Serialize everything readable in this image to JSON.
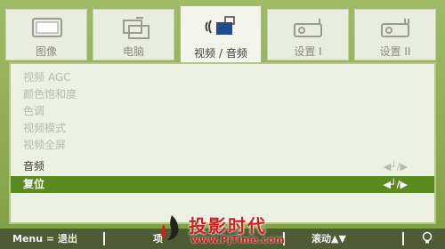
{
  "tabs": [
    {
      "label": "图像",
      "icon": "image-icon",
      "active": false
    },
    {
      "label": "电脑",
      "icon": "computer-icon",
      "active": false
    },
    {
      "label": "视频 / 音频",
      "icon": "audio-video-icon",
      "active": true
    },
    {
      "label": "设置 I",
      "icon": "projector-settings-1-icon",
      "active": false
    },
    {
      "label": "设置 II",
      "icon": "projector-settings-2-icon",
      "active": false
    }
  ],
  "menu": {
    "items": [
      {
        "label": "视频 AGC",
        "state": "disabled",
        "value": ""
      },
      {
        "label": "颜色饱和度",
        "state": "disabled",
        "value": ""
      },
      {
        "label": "色调",
        "state": "disabled",
        "value": ""
      },
      {
        "label": "视频模式",
        "state": "disabled",
        "value": ""
      },
      {
        "label": "视频全屏",
        "state": "disabled",
        "value": ""
      },
      {
        "label": "音频",
        "state": "normal",
        "value": "◀┘/▶"
      },
      {
        "label": "复位",
        "state": "selected",
        "value": "◀┘/▶"
      }
    ]
  },
  "bottom_bar": {
    "menu_exit": "Menu = 退出",
    "item_hint": "项",
    "scroll_hint": "滚动▲▼"
  },
  "watermark": {
    "title": "投影时代",
    "url": "www.PjTime.com"
  },
  "colors": {
    "background": "#8cab52",
    "selected": "#5b8a21",
    "panel": "#edf1e2",
    "bottom_bar": "#4f5b34",
    "watermark": "#d02020"
  }
}
